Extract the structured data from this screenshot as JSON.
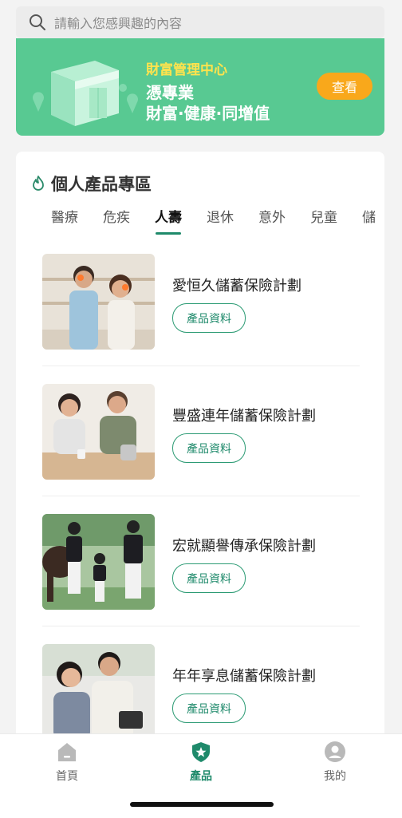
{
  "search": {
    "placeholder": "請輸入您感興趣的內容",
    "icon": "search-icon"
  },
  "banner": {
    "kicker": "財富管理中心",
    "line1": "憑專業",
    "line2": "財富·健康·同增值",
    "cta": "查看",
    "accent": "#58c992",
    "kicker_color": "#ffe34d",
    "cta_color": "#f9a81b"
  },
  "section": {
    "title": "個人產品專區",
    "icon": "flame-icon",
    "tabs": [
      "醫療",
      "危疾",
      "人壽",
      "退休",
      "意外",
      "兒童",
      "儲"
    ],
    "active_tab": "人壽"
  },
  "products": [
    {
      "name": "愛恒久儲蓄保險計劃",
      "button": "產品資料",
      "image": "couple-kitchen-photo"
    },
    {
      "name": "豐盛連年儲蓄保險計劃",
      "button": "產品資料",
      "image": "couple-tea-photo"
    },
    {
      "name": "宏就顯譽傳承保險計劃",
      "button": "產品資料",
      "image": "family-equestrian-photo"
    },
    {
      "name": "年年享息儲蓄保險計劃",
      "button": "產品資料",
      "image": "couple-reading-photo"
    }
  ],
  "nav": [
    {
      "label": "首頁",
      "icon": "home-icon"
    },
    {
      "label": "產品",
      "icon": "shield-star-icon",
      "active": true
    },
    {
      "label": "我的",
      "icon": "user-icon"
    }
  ],
  "brand_color": "#1f8a6b"
}
